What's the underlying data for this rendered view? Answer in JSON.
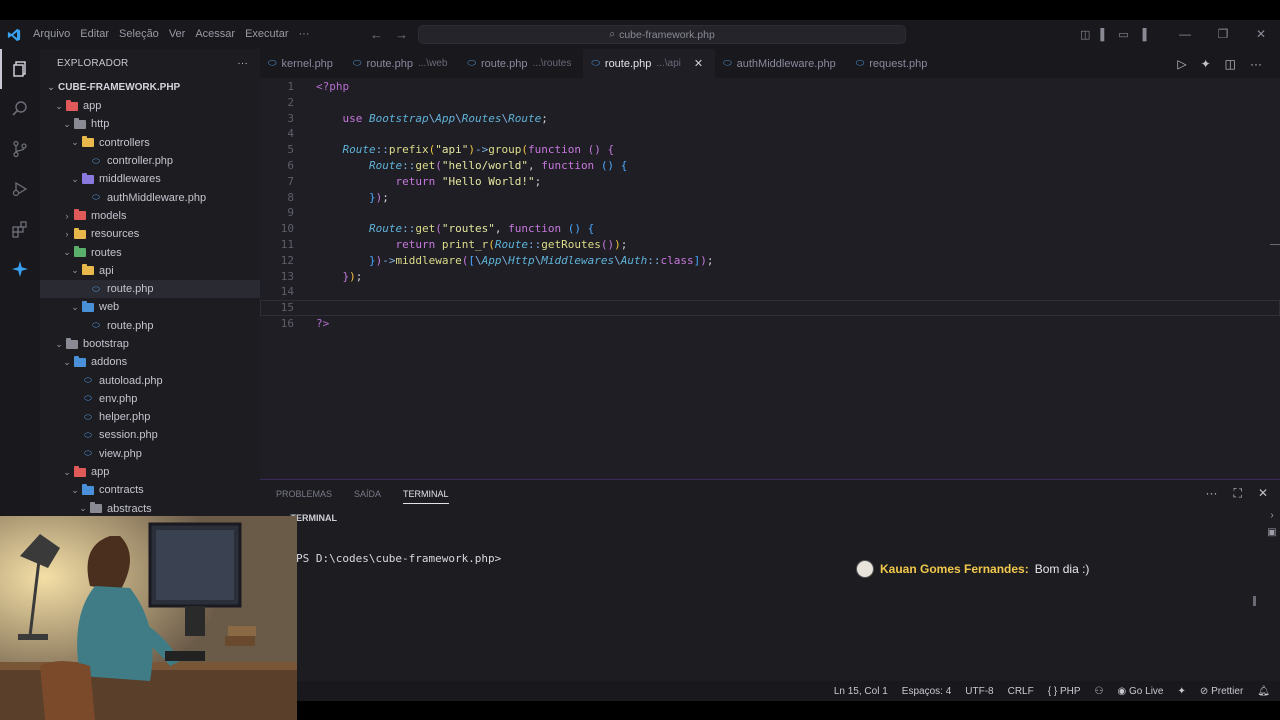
{
  "titlebar": {
    "menu": [
      "Arquivo",
      "Editar",
      "Seleção",
      "Ver",
      "Acessar",
      "Executar",
      "···"
    ],
    "search": "cube-framework.php"
  },
  "sidebar": {
    "header": "EXPLORADOR",
    "more": "···",
    "root": "CUBE-FRAMEWORK.PHP",
    "items": [
      {
        "label": "app",
        "depth": 0,
        "type": "folder",
        "open": true,
        "color": "#e05a5a"
      },
      {
        "label": "http",
        "depth": 1,
        "type": "folder",
        "open": true,
        "color": "#8a8a95"
      },
      {
        "label": "controllers",
        "depth": 2,
        "type": "folder",
        "open": true,
        "color": "#e8b84a"
      },
      {
        "label": "controller.php",
        "depth": 3,
        "type": "file"
      },
      {
        "label": "middlewares",
        "depth": 2,
        "type": "folder",
        "open": true,
        "color": "#8a7ae0"
      },
      {
        "label": "authMiddleware.php",
        "depth": 3,
        "type": "file"
      },
      {
        "label": "models",
        "depth": 1,
        "type": "folder",
        "open": false,
        "color": "#e05a5a"
      },
      {
        "label": "resources",
        "depth": 1,
        "type": "folder",
        "open": false,
        "color": "#e8b84a"
      },
      {
        "label": "routes",
        "depth": 1,
        "type": "folder",
        "open": true,
        "color": "#5ab06a"
      },
      {
        "label": "api",
        "depth": 2,
        "type": "folder",
        "open": true,
        "color": "#e8b84a"
      },
      {
        "label": "route.php",
        "depth": 3,
        "type": "file",
        "selected": true
      },
      {
        "label": "web",
        "depth": 2,
        "type": "folder",
        "open": true,
        "color": "#4a90d9"
      },
      {
        "label": "route.php",
        "depth": 3,
        "type": "file"
      },
      {
        "label": "bootstrap",
        "depth": 0,
        "type": "folder",
        "open": true,
        "color": "#8a8a95"
      },
      {
        "label": "addons",
        "depth": 1,
        "type": "folder",
        "open": true,
        "color": "#4a90d9"
      },
      {
        "label": "autoload.php",
        "depth": 2,
        "type": "file"
      },
      {
        "label": "env.php",
        "depth": 2,
        "type": "file"
      },
      {
        "label": "helper.php",
        "depth": 2,
        "type": "file"
      },
      {
        "label": "session.php",
        "depth": 2,
        "type": "file"
      },
      {
        "label": "view.php",
        "depth": 2,
        "type": "file"
      },
      {
        "label": "app",
        "depth": 1,
        "type": "folder",
        "open": true,
        "color": "#e05a5a"
      },
      {
        "label": "contracts",
        "depth": 2,
        "type": "folder",
        "open": true,
        "color": "#4a90d9"
      },
      {
        "label": "abstracts",
        "depth": 3,
        "type": "folder",
        "open": true,
        "color": "#8a8a95"
      }
    ]
  },
  "tabs": [
    {
      "label": "kernel.php",
      "desc": ""
    },
    {
      "label": "route.php",
      "desc": "...\\web"
    },
    {
      "label": "route.php",
      "desc": "...\\routes"
    },
    {
      "label": "route.php",
      "desc": "...\\api",
      "active": true
    },
    {
      "label": "authMiddleware.php",
      "desc": ""
    },
    {
      "label": "request.php",
      "desc": ""
    }
  ],
  "editor": {
    "line_numbers": [
      "1",
      "2",
      "3",
      "4",
      "5",
      "6",
      "7",
      "8",
      "9",
      "10",
      "11",
      "12",
      "13",
      "14",
      "15",
      "16"
    ],
    "current_line": 15
  },
  "panel": {
    "tabs": [
      "PROBLEMAS",
      "SAÍDA",
      "TERMINAL"
    ],
    "active_tab": "TERMINAL",
    "section": "TERMINAL",
    "prompt": "PS D:\\codes\\cube-framework.php>"
  },
  "chat": {
    "name": "Kauan Gomes Fernandes:",
    "message": "Bom dia :)"
  },
  "status": {
    "position": "Ln 15, Col 1",
    "indent": "Espaços: 4",
    "encoding": "UTF-8",
    "eol": "CRLF",
    "language": "PHP",
    "golive": "Go Live",
    "prettier": "Prettier"
  }
}
